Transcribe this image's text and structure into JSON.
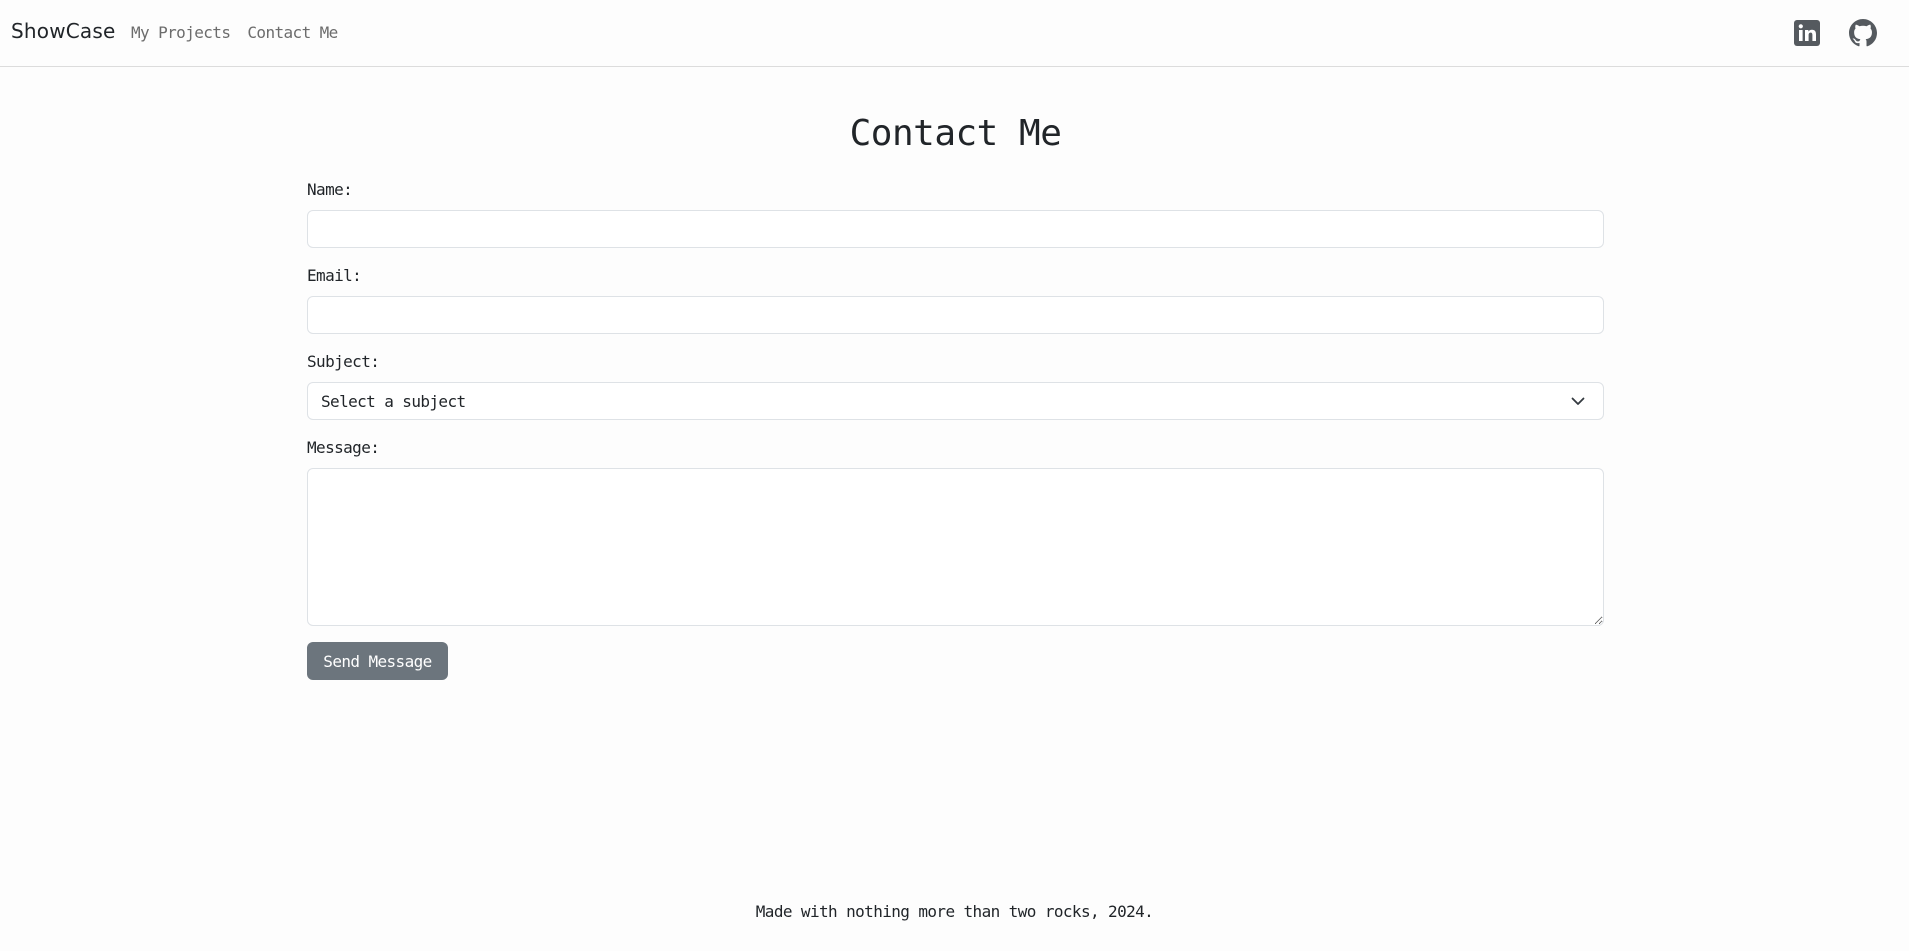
{
  "navbar": {
    "brand": "ShowCase",
    "links": [
      {
        "label": "My Projects"
      },
      {
        "label": "Contact Me"
      }
    ],
    "social": [
      {
        "icon": "linkedin-icon"
      },
      {
        "icon": "github-icon"
      }
    ]
  },
  "main": {
    "title": "Contact Me",
    "form": {
      "name": {
        "label": "Name:",
        "value": ""
      },
      "email": {
        "label": "Email:",
        "value": ""
      },
      "subject": {
        "label": "Subject:",
        "selected": "Select a subject"
      },
      "message": {
        "label": "Message:",
        "value": ""
      },
      "submit_label": "Send Message"
    }
  },
  "footer": {
    "text": "Made with nothing more than two rocks, 2024."
  },
  "colors": {
    "button_bg": "#6c757d",
    "nav_border": "#dcdcdc",
    "input_border": "#dee2e6"
  }
}
